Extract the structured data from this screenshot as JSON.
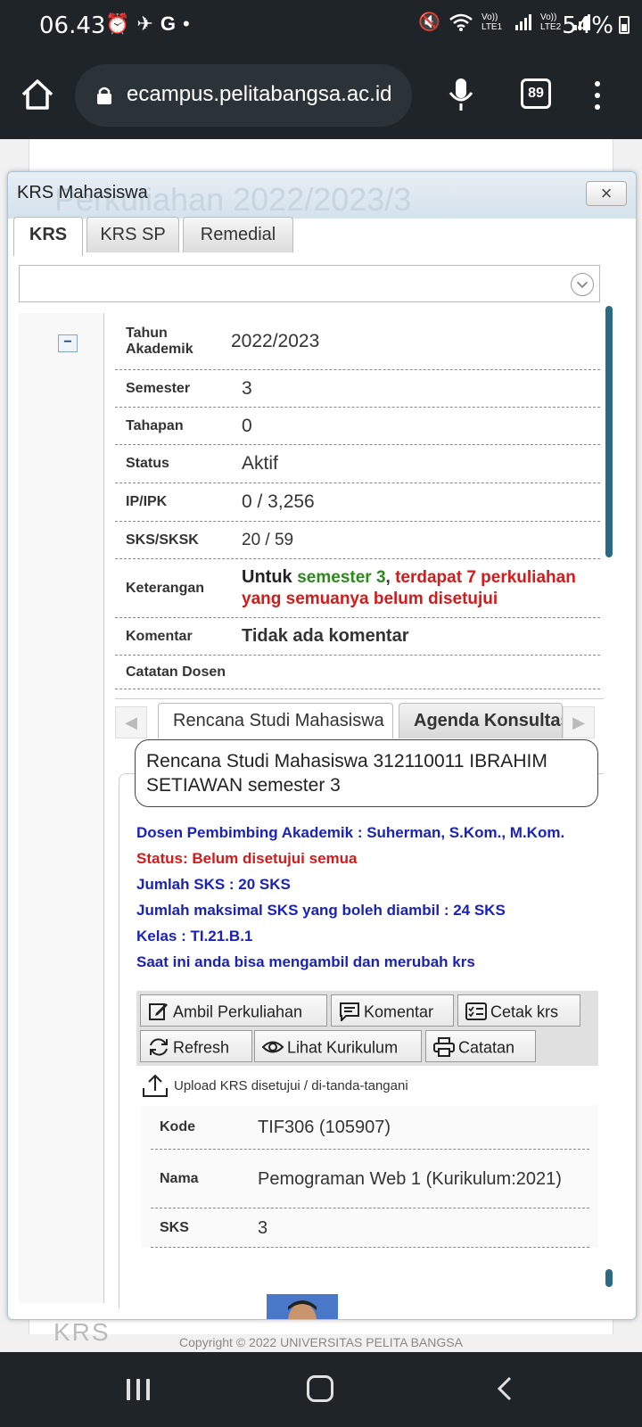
{
  "status_bar": {
    "time": "06.43",
    "left_icons": [
      "alarm-icon",
      "telegram-icon",
      "google-icon",
      "dot-icon"
    ],
    "right_icons": [
      "mute-icon",
      "wifi-icon",
      "lte1-signal-icon",
      "lte2-signal-icon"
    ],
    "lte1_label": "Vo)) LTE1",
    "lte2_label": "Vo)) LTE2",
    "battery": "54%"
  },
  "browser": {
    "url": "ecampus.pelitabangsa.ac.id",
    "tab_count": "89"
  },
  "dialog": {
    "title": "KRS Mahasiswa",
    "background_title": "Perkuliahan 2022/2023/3",
    "close_label": "×",
    "tabs": [
      {
        "label": "KRS",
        "active": true
      },
      {
        "label": "KRS SP",
        "active": false
      },
      {
        "label": "Remedial",
        "active": false
      }
    ],
    "collapse_label": "−",
    "info": [
      {
        "key": "Tahun Akademik",
        "value": "2022/2023"
      },
      {
        "key": "Semester",
        "value": "3"
      },
      {
        "key": "Tahapan",
        "value": "0"
      },
      {
        "key": "Status",
        "value": "Aktif"
      },
      {
        "key": "IP/IPK",
        "value": "0 / 3,256"
      },
      {
        "key": "SKS/SKSK",
        "value": "20 / 59"
      },
      {
        "key": "Keterangan",
        "value_parts": [
          "Untuk ",
          "semester 3",
          ", ",
          "terdapat 7 perkuliahan yang semuanya belum disetujui"
        ]
      },
      {
        "key": "Komentar",
        "value": "Tidak ada komentar"
      },
      {
        "key": "Catatan Dosen",
        "value": ""
      }
    ],
    "subtabs": [
      {
        "label": "Rencana Studi Mahasiswa",
        "active": true
      },
      {
        "label": "Agenda Konsultasi",
        "active": false
      }
    ],
    "nav_prev": "◀",
    "nav_next": "▶",
    "bubble": "Rencana Studi Mahasiswa 312110011 IBRAHIM SETIAWAN semester 3",
    "notes": [
      {
        "text": "Dosen Pembimbing Akademik : Suherman, S.Kom., M.Kom.",
        "color": "blue"
      },
      {
        "text": "Status: Belum disetujui semua",
        "color": "red"
      },
      {
        "text": "Jumlah SKS : 20 SKS",
        "color": "blue"
      },
      {
        "text": "Jumlah maksimal SKS yang boleh diambil : 24 SKS",
        "color": "blue"
      },
      {
        "text": "Kelas : TI.21.B.1",
        "color": "blue"
      },
      {
        "text": "Saat ini anda bisa mengambil dan merubah krs",
        "color": "blue"
      }
    ],
    "toolbar": {
      "ambil": "Ambil Perkuliahan",
      "komentar": "Komentar",
      "cetak": "Cetak krs",
      "refresh": "Refresh",
      "kurikulum": "Lihat Kurikulum",
      "catatan": "Catatan"
    },
    "upload_label": "Upload KRS disetujui / di-tanda-tangani",
    "course": [
      {
        "key": "Kode",
        "value": "TIF306 (105907)"
      },
      {
        "key": "Nama",
        "value": "Pemograman Web 1 (Kurikulum:2021)"
      },
      {
        "key": "SKS",
        "value": "3"
      }
    ]
  },
  "page": {
    "copyright": "Copyright © 2022 UNIVERSITAS PELITA BANGSA",
    "watermark": "KRS"
  },
  "colors": {
    "accent_blue": "#1a22b8",
    "status_red": "#d51a1a",
    "semester_green": "#2a8a1a",
    "scroll_thumb": "#2b6a85"
  }
}
